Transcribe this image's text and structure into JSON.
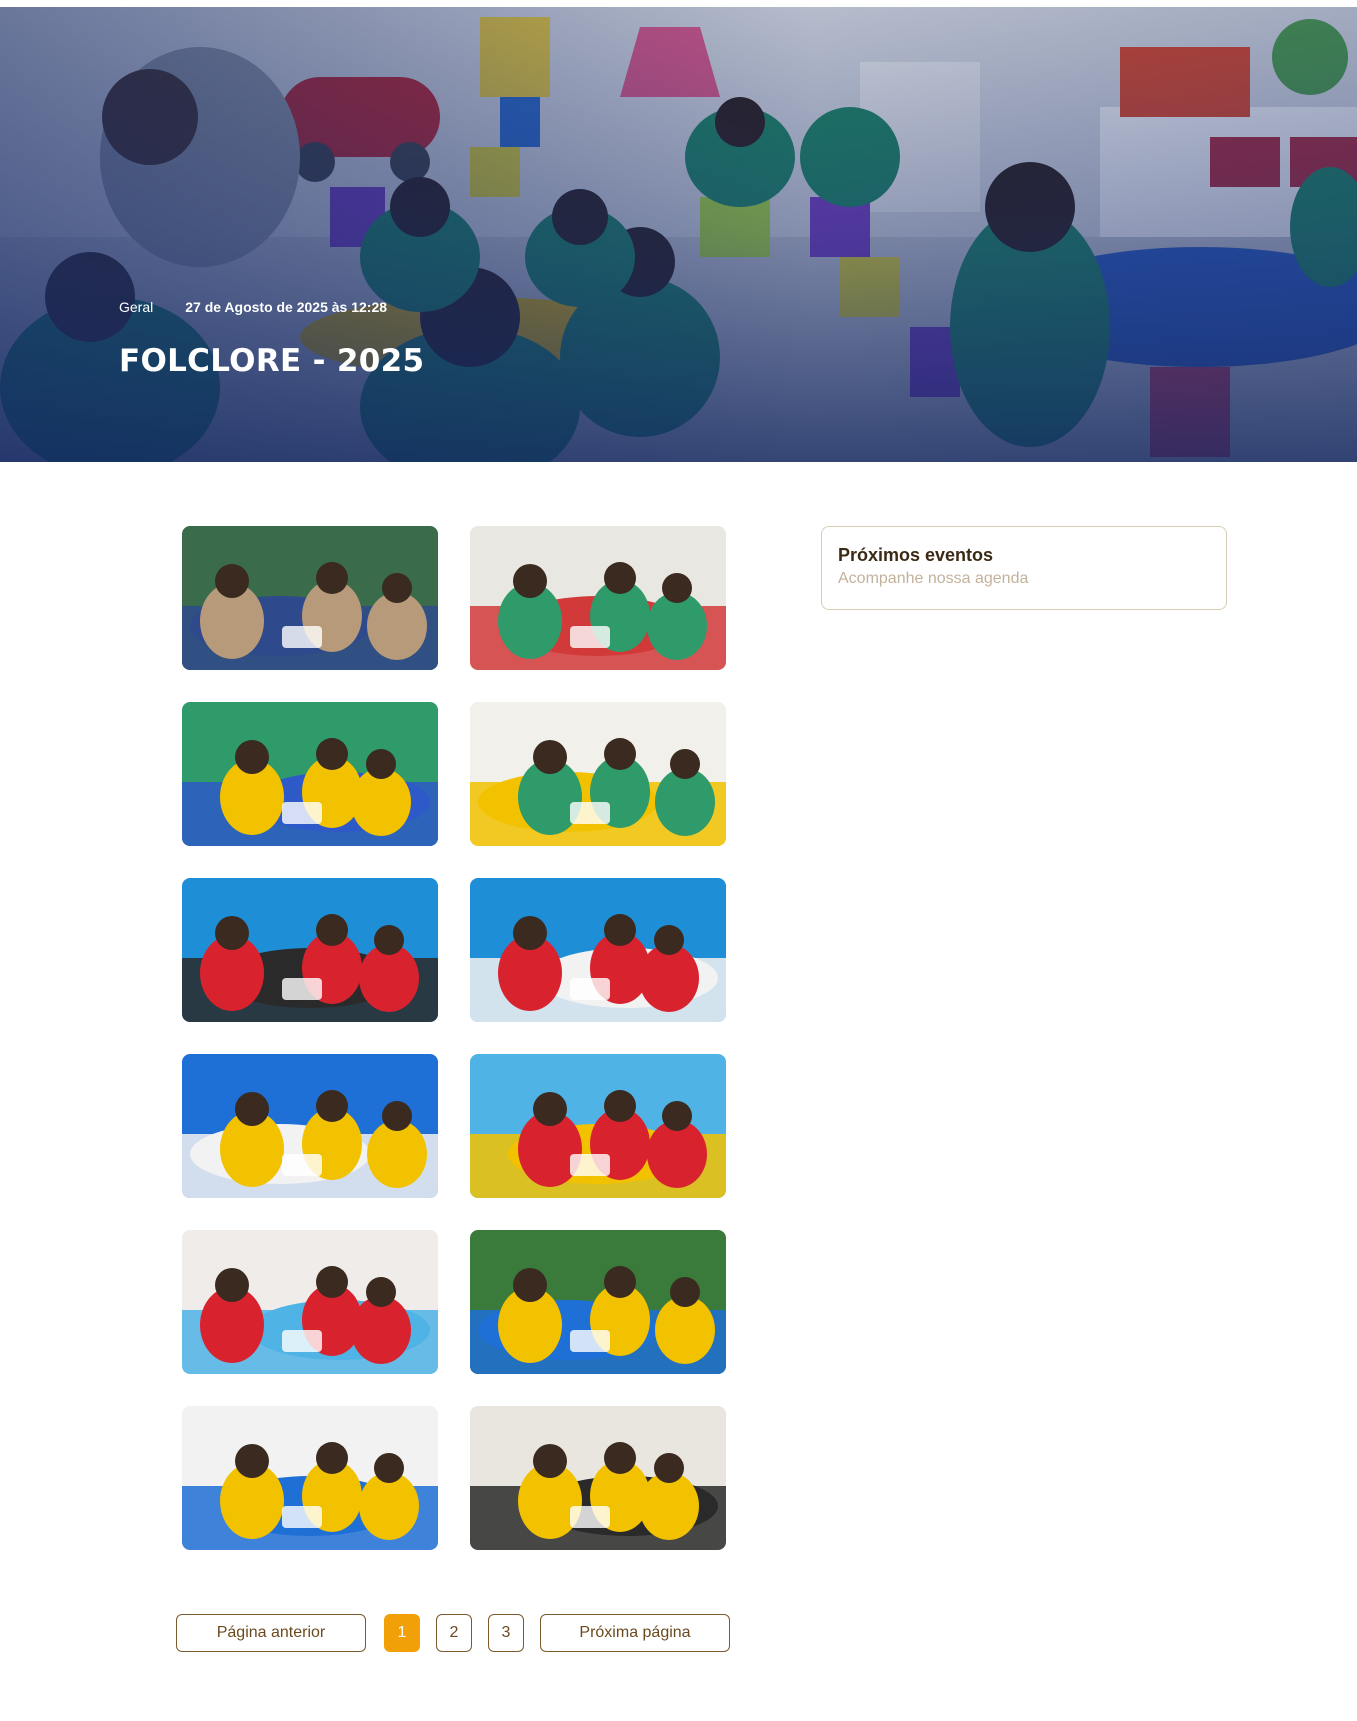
{
  "hero": {
    "category": "Geral",
    "date": "27 de Agosto de 2025 às 12:28",
    "title": "FOLCLORE - 2025"
  },
  "gallery": {
    "photos": [
      {
        "alt": "Crianças sentadas na quadra assistindo apresentação",
        "palette": [
          "#3a6b4a",
          "#b79a7a",
          "#2f4a8c"
        ]
      },
      {
        "alt": "Sala de aula com crianças e professora",
        "palette": [
          "#e9e7e2",
          "#2f9a6a",
          "#d23a3a"
        ]
      },
      {
        "alt": "Crianças pintando em mesa",
        "palette": [
          "#2f9a6a",
          "#f2c200",
          "#2e59c8"
        ]
      },
      {
        "alt": "Crianças com máscaras pintando",
        "palette": [
          "#f2f0ea",
          "#2f9a6a",
          "#f2c200"
        ]
      },
      {
        "alt": "Crianças com gorros vermelhos e professora",
        "palette": [
          "#1e8fd6",
          "#d8232f",
          "#2a2a2a"
        ]
      },
      {
        "alt": "Crianças com gorros vermelhos em roda",
        "palette": [
          "#1e8fd6",
          "#d8232f",
          "#f2f2f2"
        ]
      },
      {
        "alt": "Crianças pintando caixa na mesa azul",
        "palette": [
          "#1e6fd6",
          "#f2c200",
          "#f2f2f2"
        ]
      },
      {
        "alt": "Crianças com gorros vermelhos pintando",
        "palette": [
          "#4fb3e6",
          "#d8232f",
          "#f2c200"
        ]
      },
      {
        "alt": "Meninas com gorros vermelhos pintando",
        "palette": [
          "#f0ecea",
          "#d8232f",
          "#4fb3e6"
        ]
      },
      {
        "alt": "Meninos pintando na mesa amarela",
        "palette": [
          "#3a7a3a",
          "#f2c200",
          "#1e6fd6"
        ]
      },
      {
        "alt": "Meninas brincando com garrafas",
        "palette": [
          "#f2f2f2",
          "#f2c200",
          "#1e6fd6"
        ]
      },
      {
        "alt": "Meninos com garrafas na mesa amarela",
        "palette": [
          "#e9e6e0",
          "#f2c200",
          "#2a2a2a"
        ]
      }
    ]
  },
  "sidebar": {
    "events_title": "Próximos eventos",
    "events_subtitle": "Acompanhe nossa agenda"
  },
  "pagination": {
    "prev_label": "Página anterior",
    "next_label": "Próxima página",
    "pages": [
      "1",
      "2",
      "3"
    ],
    "current": "1",
    "active_color": "#f2a007",
    "border_color": "#7a5a2e"
  }
}
